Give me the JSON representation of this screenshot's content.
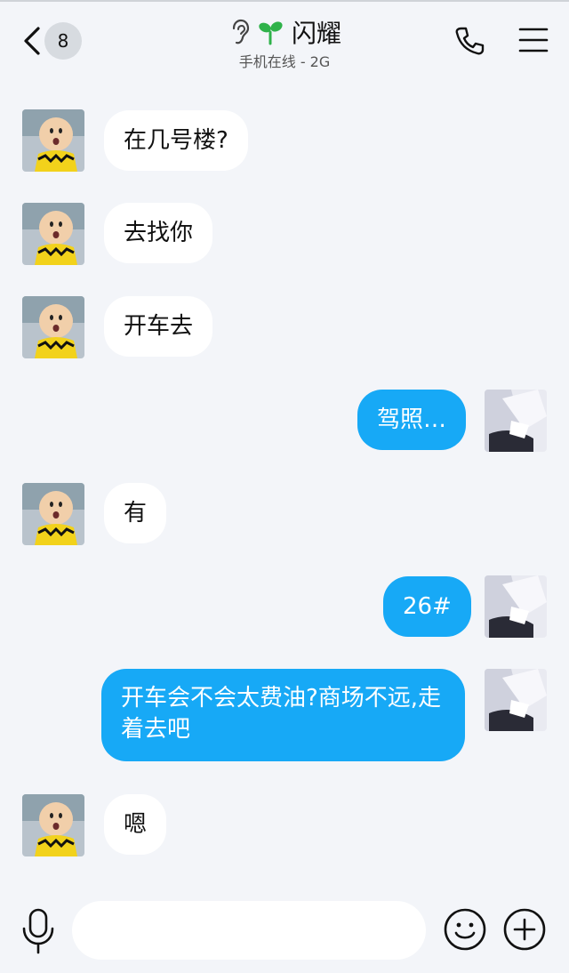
{
  "header": {
    "unread_count": "8",
    "title": "闪耀",
    "subtitle": "手机在线 - 2G"
  },
  "messages": [
    {
      "side": "in",
      "text": "在几号楼?"
    },
    {
      "side": "in",
      "text": "去找你"
    },
    {
      "side": "in",
      "text": "开车去"
    },
    {
      "side": "out",
      "text": "驾照…"
    },
    {
      "side": "in",
      "text": "有"
    },
    {
      "side": "out",
      "text": "26#"
    },
    {
      "side": "out",
      "text": "开车会不会太费油?商场不远,走着去吧"
    },
    {
      "side": "in",
      "text": "嗯"
    }
  ],
  "input": {
    "value": "",
    "placeholder": ""
  },
  "colors": {
    "background": "#f3f5f9",
    "bubble_in": "#ffffff",
    "bubble_out": "#17a9f6",
    "title_icon_green": "#2fb24a"
  },
  "icons": {
    "back": "chevron-left-icon",
    "ear": "ear-icon",
    "sprout": "sprout-icon",
    "call": "phone-icon",
    "menu": "menu-icon",
    "mic": "microphone-icon",
    "emoji": "smiley-icon",
    "plus": "plus-circle-icon"
  }
}
